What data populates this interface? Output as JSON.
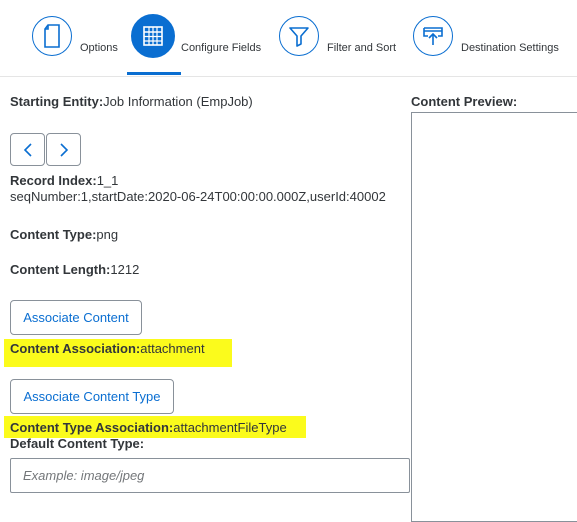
{
  "steps": [
    {
      "label": "Options",
      "icon": "document-icon"
    },
    {
      "label": "Configure Fields",
      "icon": "table-icon",
      "active": true
    },
    {
      "label": "Filter and Sort",
      "icon": "filter-icon"
    },
    {
      "label": "Destination Settings",
      "icon": "upload-icon"
    }
  ],
  "form": {
    "starting_entity_label": "Starting Entity:",
    "starting_entity_value": "Job Information (EmpJob)",
    "record_index_label": "Record Index:",
    "record_index_value": "1_1",
    "record_key": "seqNumber:1,startDate:2020-06-24T00:00:00.000Z,userId:40002",
    "content_type_label": "Content Type:",
    "content_type_value": "png",
    "content_length_label": "Content Length:",
    "content_length_value": "1212",
    "associate_content_button": "Associate Content",
    "content_association_label": "Content Association:",
    "content_association_value": "attachment",
    "associate_content_type_button": "Associate Content Type",
    "content_type_association_label": "Content Type Association:",
    "content_type_association_value": "attachmentFileType",
    "default_content_type_label": "Default Content Type:",
    "default_content_type_placeholder": "Example: image/jpeg"
  },
  "preview": {
    "label": "Content Preview:"
  },
  "colors": {
    "accent": "#0a6ed1",
    "highlight": "#fbfb1c",
    "text": "#32363a"
  }
}
